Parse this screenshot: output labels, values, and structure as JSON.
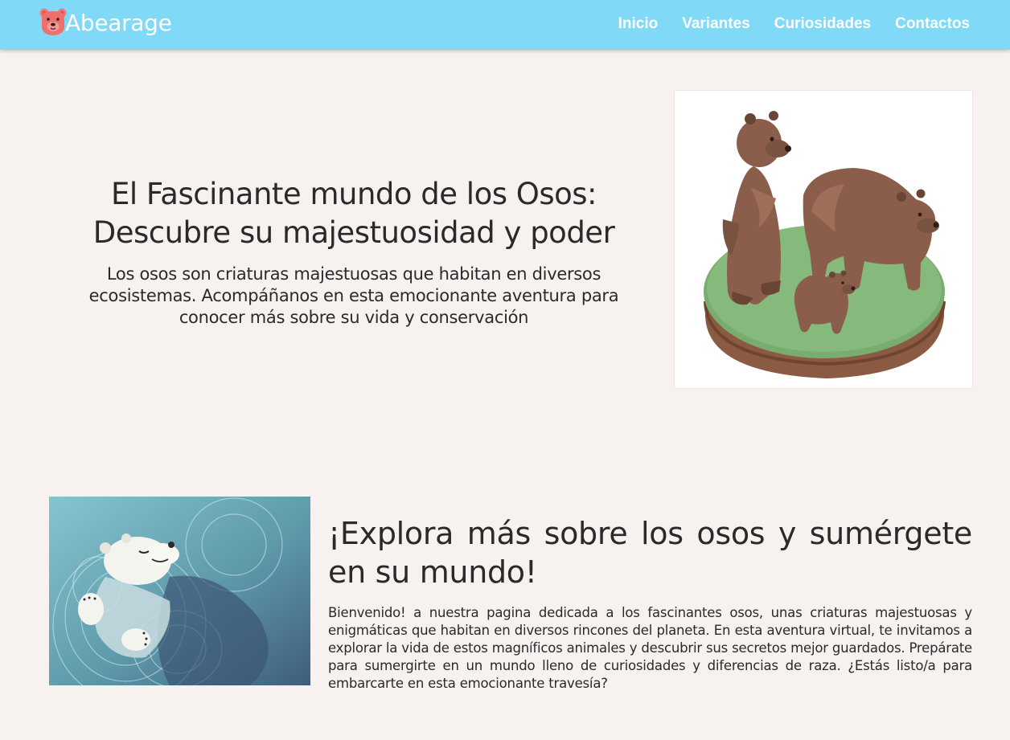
{
  "navbar": {
    "brand_name": "Abearage",
    "logo_icon": "bear-face-icon",
    "links": [
      {
        "label": "Inicio"
      },
      {
        "label": "Variantes"
      },
      {
        "label": "Curiosidades"
      },
      {
        "label": "Contactos"
      }
    ]
  },
  "hero": {
    "title": "El Fascinante mundo de los Osos: Descubre su majestuosidad y poder",
    "subtitle": "Los osos son criaturas majestuosas que habitan en diversos ecosistemas. Acompáñanos en esta emocionante aventura para conocer más sobre su vida y conservación",
    "image": "brown-bears-family-illustration"
  },
  "explore": {
    "title": "¡Explora más sobre los osos y sumérgete en su mundo!",
    "body": "Bienvenido! a nuestra pagina dedicada a los fascinantes osos, unas criaturas majestuosas y enigmáticas que habitan en diversos rincones del planeta. En esta aventura virtual, te invitamos a explorar la vida de estos magníficos animales y descubrir sus secretos mejor guardados. Prepárate para sumergirte en un mundo lleno de curiosidades y diferencias de raza. ¿Estás listo/a para embarcarte en esta emocionante travesía?",
    "image": "polar-bear-swimming-illustration"
  },
  "colors": {
    "navbar_bg": "#7fd9f7",
    "page_bg": "#f7f2ef",
    "text": "#2a2a2a",
    "logo": "#ef6f6c"
  }
}
